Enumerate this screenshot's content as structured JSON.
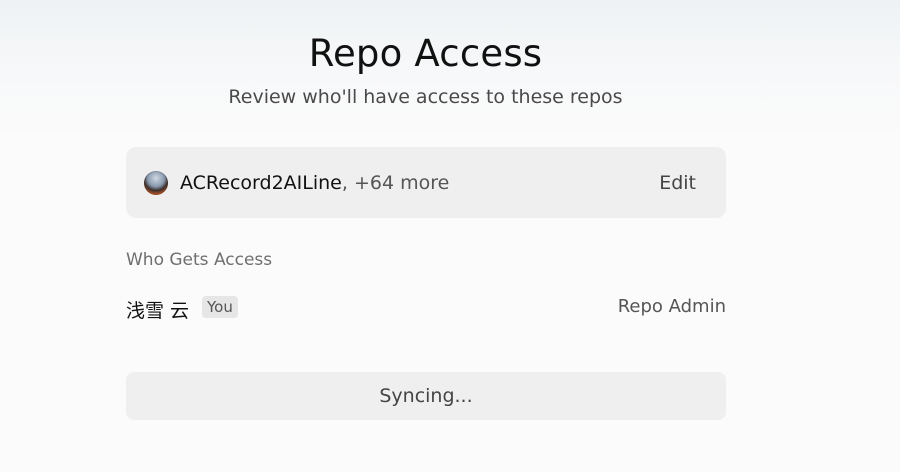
{
  "header": {
    "title": "Repo Access",
    "subtitle": "Review who'll have access to these repos"
  },
  "repo_card": {
    "repo_name": "ACRecord2AILine",
    "more_text": ", +64 more",
    "edit_label": "Edit",
    "avatar_icon": "repo-avatar-photo"
  },
  "access": {
    "section_label": "Who Gets Access",
    "users": [
      {
        "name": "浅雪 云",
        "badge": "You",
        "role": "Repo Admin"
      }
    ]
  },
  "footer": {
    "sync_label": "Syncing..."
  }
}
